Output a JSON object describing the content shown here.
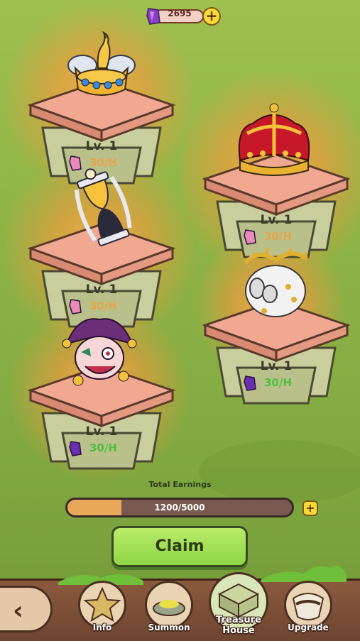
{
  "currency": {
    "amount": "2695",
    "plus": "+",
    "icon": "purple-gem-icon"
  },
  "pedestals": [
    {
      "id": "crown-nest",
      "level": "Lv. 1",
      "rate": "30/H",
      "active": false
    },
    {
      "id": "hourglass",
      "level": "Lv. 1",
      "rate": "30/H",
      "active": false
    },
    {
      "id": "jester",
      "level": "Lv. 1",
      "rate": "30/H",
      "active": true
    },
    {
      "id": "royal-crown",
      "level": "Lv. 1",
      "rate": "30/H",
      "active": false
    },
    {
      "id": "laurel-ghost",
      "level": "Lv. 1",
      "rate": "30/H",
      "active": true
    }
  ],
  "earnings": {
    "label": "Total Earnings",
    "progress_text": "1200/5000",
    "current": 1200,
    "max": 5000,
    "plus": "+"
  },
  "claim_label": "Claim",
  "nav": {
    "back": "‹",
    "items": [
      {
        "label": "Info"
      },
      {
        "label": "Summon"
      },
      {
        "label": "Treasure House"
      },
      {
        "label": "Upgrade"
      }
    ]
  },
  "colors": {
    "active_rate": "#4fbf42",
    "inactive_rate": "#e4a54a",
    "claim": "#8fd646",
    "bar_fill": "#e8a85a"
  }
}
